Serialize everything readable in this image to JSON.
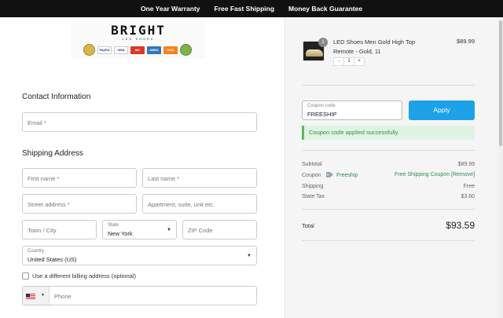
{
  "topbar": {
    "items": [
      "One Year Warranty",
      "Free Fast Shipping",
      "Money Back Guarantee"
    ]
  },
  "logo": {
    "brand": "BRIGHT",
    "sub": "LED SHOES",
    "payment_cards": [
      "PayPal",
      "VISA",
      "MC",
      "AMEX",
      "DISC"
    ]
  },
  "contact": {
    "title": "Contact Information",
    "email_placeholder": "Email *"
  },
  "shipping": {
    "title": "Shipping Address",
    "first_name_placeholder": "First name *",
    "last_name_placeholder": "Last name *",
    "street_placeholder": "Street address *",
    "apartment_placeholder": "Apartment, suite, unit etc.",
    "city_placeholder": "Town / City",
    "state_label": "State",
    "state_value": "New York",
    "zip_placeholder": "ZIP Code",
    "country_label": "Country",
    "country_value": "United States (US)",
    "billing_checkbox_label": "Use a different billing address (optional)",
    "phone_placeholder": "Phone"
  },
  "cart": {
    "item": {
      "quantity_badge": "1",
      "name": "LED Shoes Men Gold High Top Remote - Gold, 11",
      "price": "$89.99",
      "qty_minus": "-",
      "qty_value": "1",
      "qty_plus": "+"
    },
    "coupon": {
      "label": "Coupon code",
      "value": "FREESHIP",
      "apply_label": "Apply",
      "success_message": "Coupon code applied successfully."
    },
    "summary": {
      "subtotal_label": "Subtotal",
      "subtotal_value": "$89.99",
      "coupon_label": "Coupon",
      "coupon_code": "Freeship",
      "coupon_value": "Free Shipping Coupon [Remove]",
      "shipping_label": "Shipping",
      "shipping_value": "Free",
      "tax_label": "State Tax",
      "tax_value": "$3.60",
      "total_label": "Total",
      "total_value": "$93.59"
    }
  },
  "colors": {
    "topbar": "#111111",
    "apply_button": "#1da1e8",
    "success_bg": "#dff3e4",
    "success_text": "#3c8c4a",
    "coupon_green": "#2e8b57"
  }
}
